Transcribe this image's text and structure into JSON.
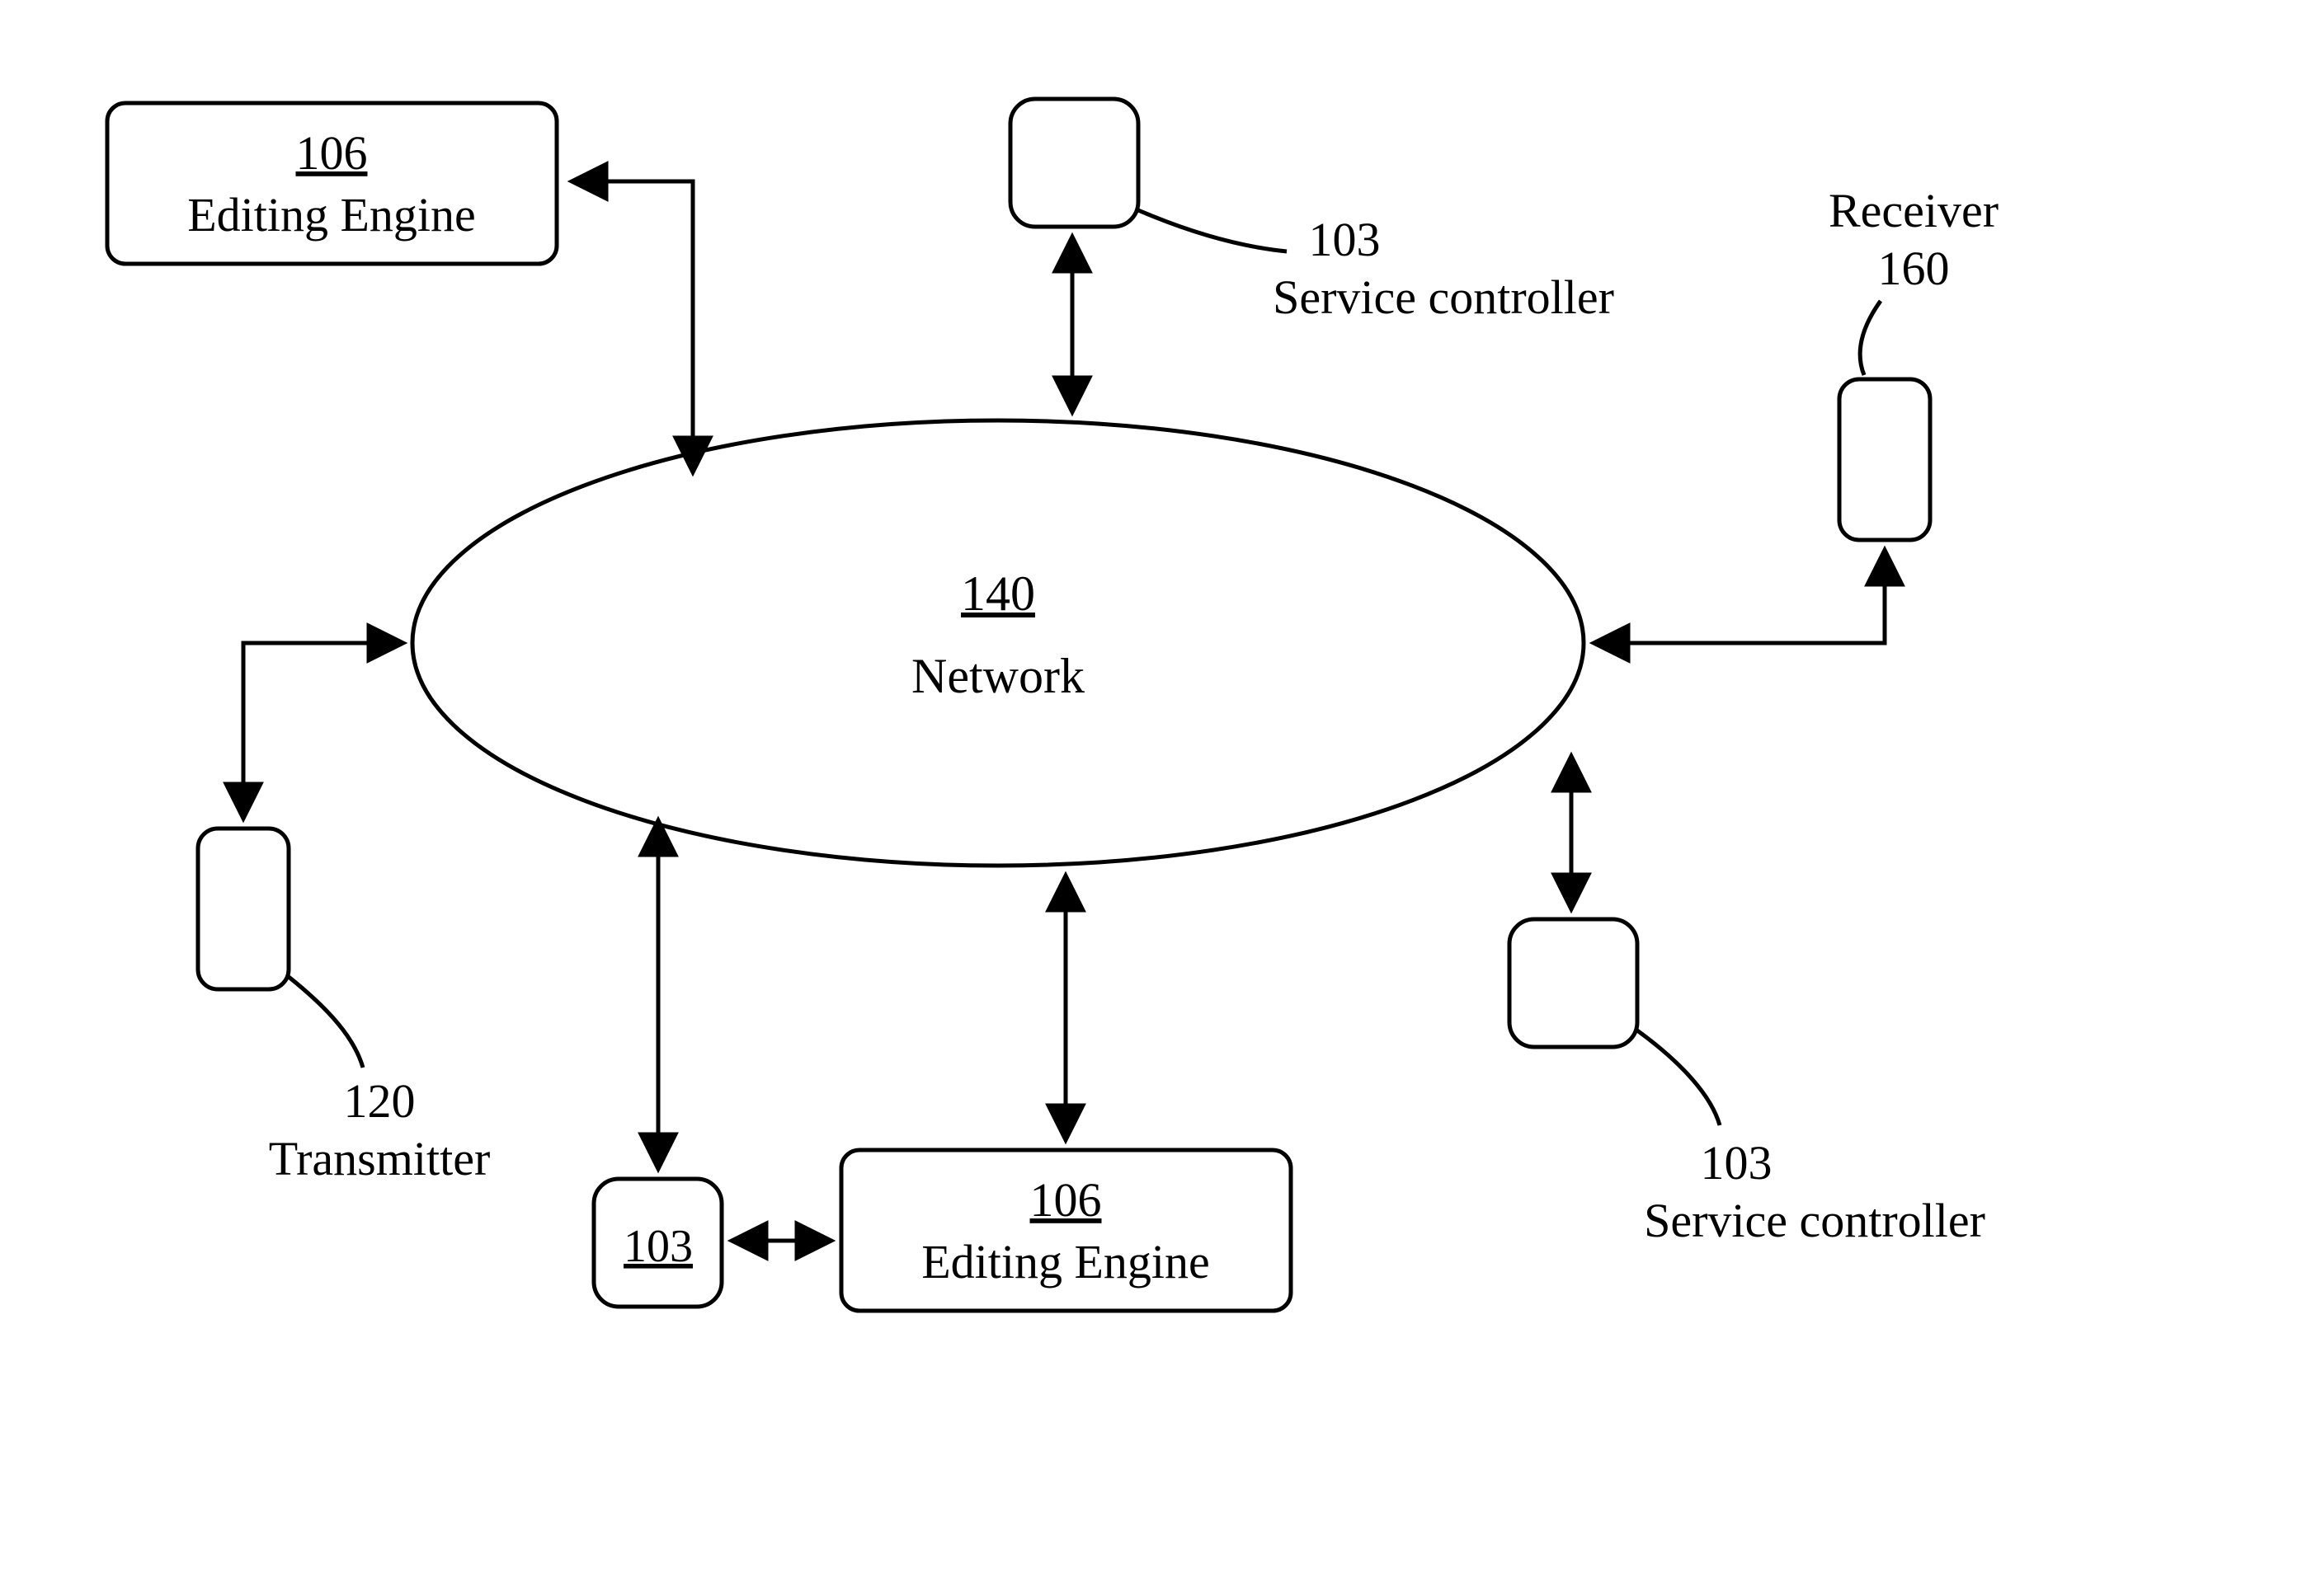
{
  "network": {
    "num": "140",
    "label": "Network"
  },
  "editing_top": {
    "num": "106",
    "label": "Editing Engine"
  },
  "editing_bottom": {
    "num": "106",
    "label": "Editing Engine"
  },
  "sc_top": {
    "num": "103",
    "label": "Service controller"
  },
  "sc_bottom_right": {
    "num": "103",
    "label": "Service controller"
  },
  "sc_bottom_left": {
    "num": "103"
  },
  "transmitter": {
    "num": "120",
    "label": "Transmitter"
  },
  "receiver": {
    "num": "160",
    "label": "Receiver"
  }
}
